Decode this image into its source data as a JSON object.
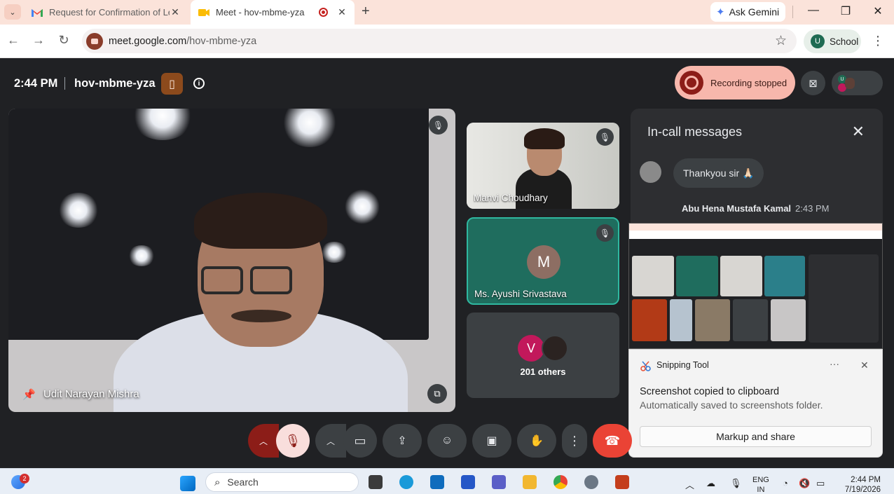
{
  "browser": {
    "tabs": [
      {
        "label": "Request for Confirmation of Lec",
        "close": "✕"
      },
      {
        "label": "Meet - hov-mbme-yza",
        "close": "✕"
      }
    ],
    "new_tab": "+",
    "gemini_label": "Ask Gemini",
    "url_host": "meet.google.com",
    "url_path": "/hov-mbme-yza",
    "profile_initial": "U",
    "profile_label": "School"
  },
  "meet": {
    "time": "2:44 PM",
    "meeting_code": "hov-mbme-yza",
    "recording_status": "Recording stopped",
    "main_participant": "Udit Narayan Mishra",
    "participants": [
      {
        "name": "Manvi Choudhary"
      },
      {
        "name": "Ms. Ayushi Srivastava",
        "initial": "M"
      },
      {
        "others_initial": "V",
        "label": "201 others"
      }
    ],
    "chip_initial": "U"
  },
  "messages_panel": {
    "title": "In-call messages",
    "messages": [
      {
        "text": "Thankyou sir 🙏🏻"
      }
    ],
    "next_sender": "Abu Hena Mustafa Kamal",
    "next_time": "2:43 PM"
  },
  "snipping": {
    "app": "Snipping Tool",
    "dots": "···",
    "close": "✕",
    "heading": "Screenshot copied to clipboard",
    "subtext": "Automatically saved to screenshots folder.",
    "button": "Markup and share"
  },
  "taskbar": {
    "badge_count": "2",
    "search_label": "Search",
    "lang_top": "ENG",
    "lang_bottom": "IN",
    "clock_time": "2:44 PM",
    "clock_date": "7/19/2026"
  },
  "colors": {
    "meet_bg": "#202124",
    "end_call": "#ea4335",
    "recording_pill": "#f7b7ac",
    "mic_off": "#f9dedc"
  }
}
